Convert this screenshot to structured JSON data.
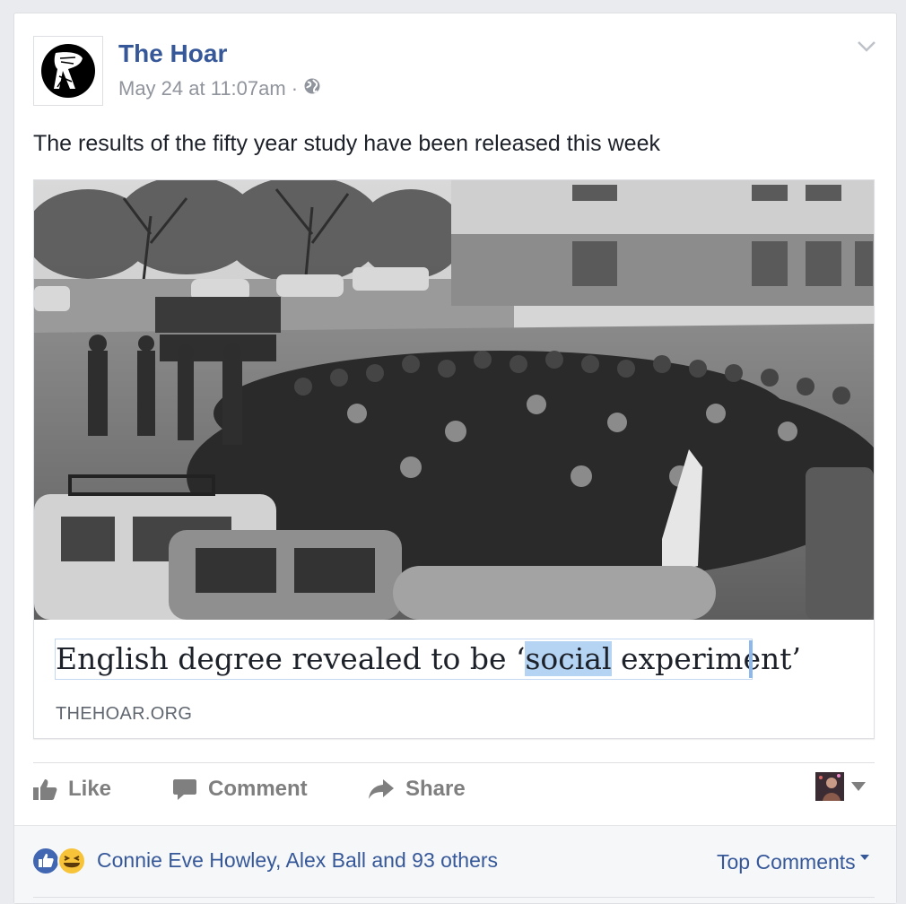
{
  "post": {
    "page_name": "The Hoar",
    "timestamp": "May 24 at 11:07am",
    "separator": "·",
    "privacy_icon": "globe-icon",
    "text": "The results of the fifty year study have been released this week"
  },
  "link": {
    "headline_before": "English degree revealed to be ‘",
    "headline_selected": "social",
    "headline_after": " experiment’",
    "domain": "THEHOAR.ORG",
    "image": "black-and-white-student-protest-crowd-photo"
  },
  "actions": {
    "like_label": "Like",
    "comment_label": "Comment",
    "share_label": "Share"
  },
  "reactions": {
    "icons": [
      "like-reaction-icon",
      "haha-reaction-icon"
    ],
    "summary": "Connie Eve Howley, Alex Ball and 93 others",
    "sort_label": "Top Comments"
  },
  "colors": {
    "link_blue": "#365899",
    "muted_grey": "#90949c",
    "like_blue": "#4267b2",
    "haha_yellow": "#f7c338"
  }
}
